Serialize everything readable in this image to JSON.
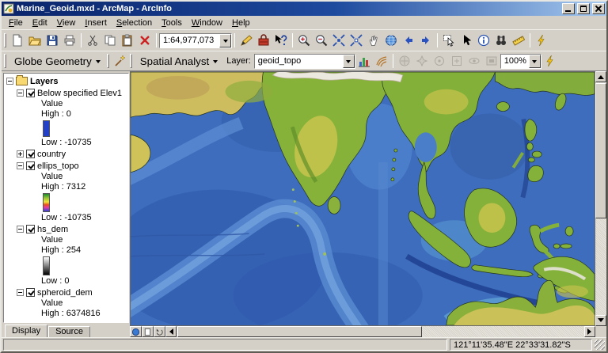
{
  "window": {
    "title": "Marine_Geoid.mxd - ArcMap - ArcInfo"
  },
  "menu": {
    "items": [
      "File",
      "Edit",
      "View",
      "Insert",
      "Selection",
      "Tools",
      "Window",
      "Help"
    ]
  },
  "toolbar_standard": {
    "scale_value": "1:64,977,073"
  },
  "toolbar_analyst": {
    "globe_geometry_label": "Globe Geometry",
    "spatial_analyst_label": "Spatial Analyst",
    "layer_label": "Layer:",
    "layer_value": "geoid_topo",
    "zoom_value": "100%"
  },
  "toc": {
    "root_label": "Layers",
    "layers": [
      {
        "name": "Below specified Elev1",
        "value_label": "Value",
        "high_label": "High : 0",
        "low_label": "Low : -10735"
      },
      {
        "name": "country"
      },
      {
        "name": "ellips_topo",
        "value_label": "Value",
        "high_label": "High : 7312",
        "low_label": "Low : -10735"
      },
      {
        "name": "hs_dem",
        "value_label": "Value",
        "high_label": "High : 254",
        "low_label": "Low : 0"
      },
      {
        "name": "spheroid_dem",
        "value_label": "Value",
        "high_label": "High : 6374816"
      }
    ],
    "tabs": [
      "Display",
      "Source"
    ]
  },
  "status_bar": {
    "coordinates": "121°11'35.48\"E  22°33'31.82\"S"
  },
  "colors": {
    "titlebar_left": "#0a246a",
    "titlebar_right": "#a6caf0",
    "chrome": "#d4d0c8",
    "ocean": "#3e6dbd",
    "land_green": "#84b13a",
    "land_yellow": "#ccc44e"
  }
}
